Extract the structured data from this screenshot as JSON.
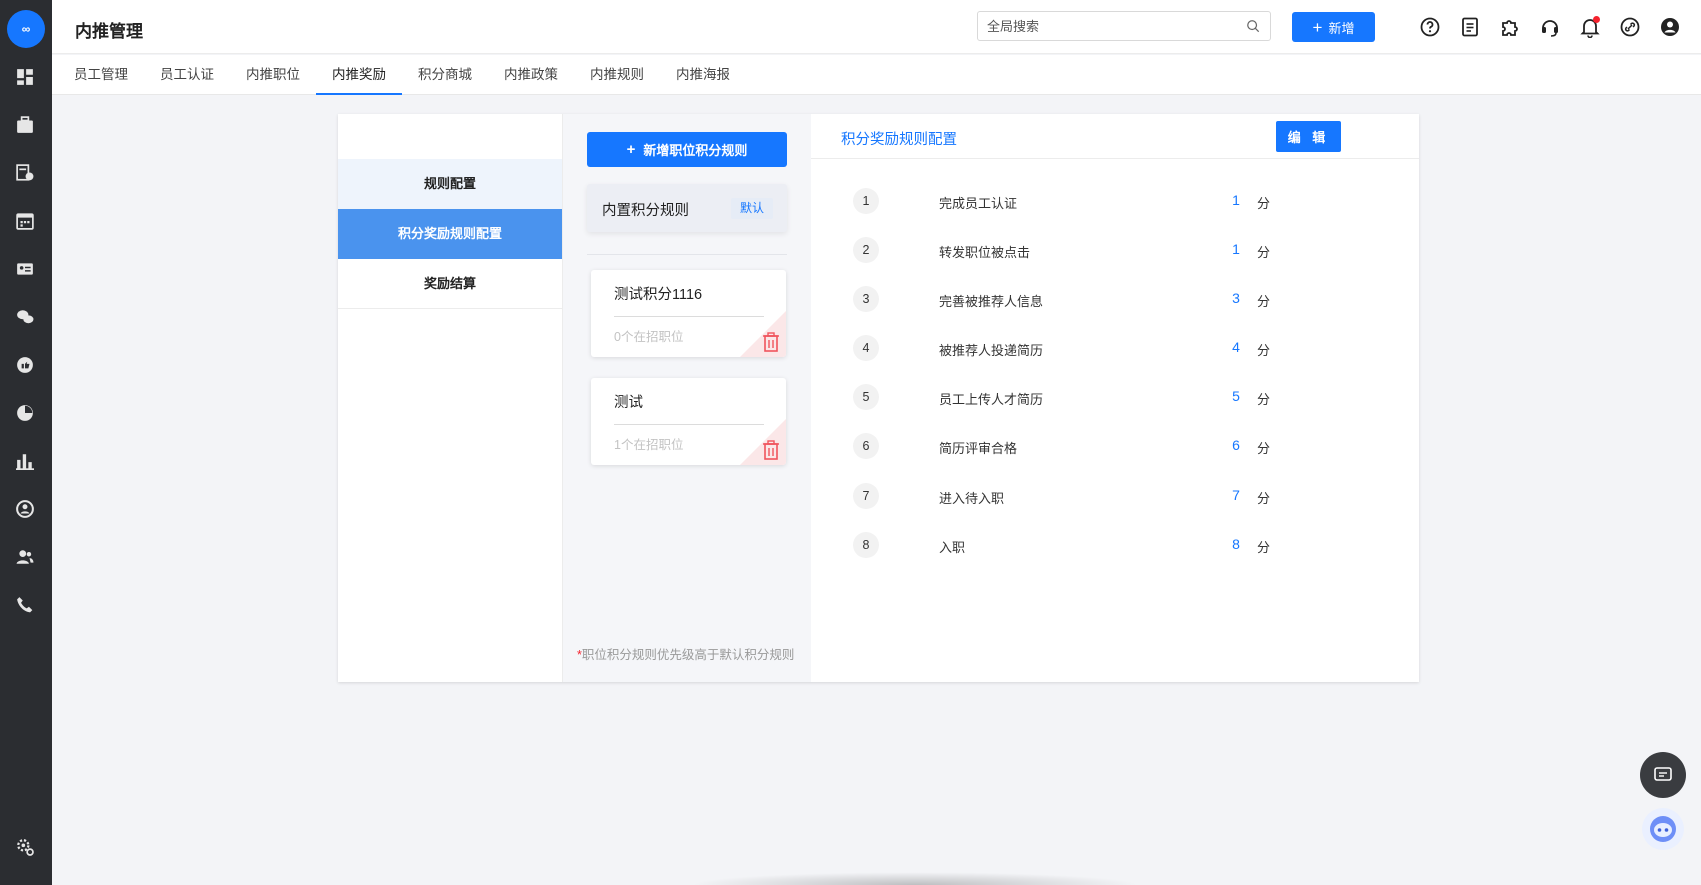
{
  "app": {
    "logo_text": "∞"
  },
  "header": {
    "title": "内推管理",
    "search_placeholder": "全局搜索",
    "new_label": "新增"
  },
  "tabs": [
    {
      "label": "员工管理"
    },
    {
      "label": "员工认证"
    },
    {
      "label": "内推职位"
    },
    {
      "label": "内推奖励",
      "active": true
    },
    {
      "label": "积分商城"
    },
    {
      "label": "内推政策"
    },
    {
      "label": "内推规则"
    },
    {
      "label": "内推海报"
    }
  ],
  "left_menu": [
    {
      "label": "规则配置"
    },
    {
      "label": "积分奖励规则配置",
      "active": true
    },
    {
      "label": "奖励结算"
    }
  ],
  "rules_column": {
    "add_button": "新增职位积分规则",
    "builtin": {
      "name": "内置积分规则",
      "badge": "默认"
    },
    "cards": [
      {
        "name": "测试积分1116",
        "count": "0个在招职位"
      },
      {
        "name": "测试",
        "count": "1个在招职位"
      }
    ],
    "note_star": "*",
    "note": "职位积分规则优先级高于默认积分规则"
  },
  "config": {
    "title": "积分奖励规则配置",
    "edit_label": "编 辑",
    "unit": "分",
    "rows": [
      {
        "no": "1",
        "label": "完成员工认证",
        "points": "1"
      },
      {
        "no": "2",
        "label": "转发职位被点击",
        "points": "1"
      },
      {
        "no": "3",
        "label": "完善被推荐人信息",
        "points": "3"
      },
      {
        "no": "4",
        "label": "被推荐人投递简历",
        "points": "4"
      },
      {
        "no": "5",
        "label": "员工上传人才简历",
        "points": "5"
      },
      {
        "no": "6",
        "label": "简历评审合格",
        "points": "6"
      },
      {
        "no": "7",
        "label": "进入待入职",
        "points": "7"
      },
      {
        "no": "8",
        "label": "入职",
        "points": "8"
      }
    ]
  },
  "colors": {
    "accent": "#1677ff",
    "sidebar": "#2b2d31",
    "menu_active": "#4a93ee",
    "menu_first": "#eef4fc"
  }
}
